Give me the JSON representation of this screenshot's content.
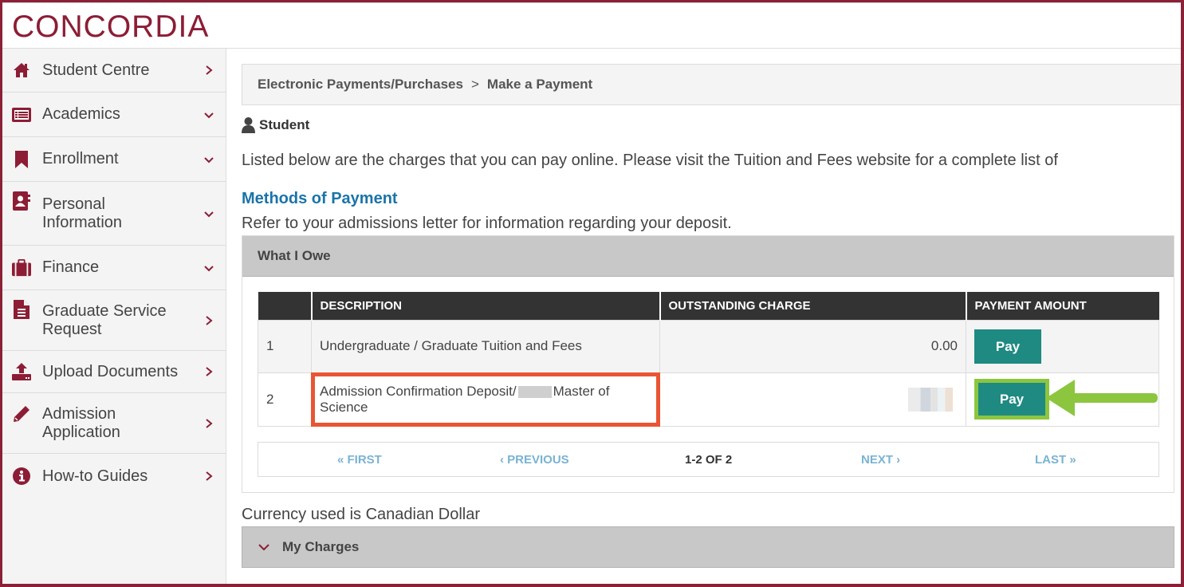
{
  "brand": {
    "logo_text": "CONCORDIA",
    "color": "#8c1d35"
  },
  "sidebar": {
    "items": [
      {
        "label": "Student Centre",
        "icon": "home-icon",
        "chevron": "right"
      },
      {
        "label": "Academics",
        "icon": "list-icon",
        "chevron": "down"
      },
      {
        "label": "Enrollment",
        "icon": "bookmark-icon",
        "chevron": "down"
      },
      {
        "label": "Personal Information",
        "line1": "Personal",
        "line2": "Information",
        "icon": "contact-book-icon",
        "chevron": "down"
      },
      {
        "label": "Finance",
        "icon": "briefcase-icon",
        "chevron": "down"
      },
      {
        "label": "Graduate Service Request",
        "line1": "Graduate Service",
        "line2": "Request",
        "icon": "document-icon",
        "chevron": "right"
      },
      {
        "label": "Upload Documents",
        "icon": "upload-icon",
        "chevron": "right"
      },
      {
        "label": "Admission Application",
        "line1": "Admission",
        "line2": "Application",
        "icon": "pencil-icon",
        "chevron": "right"
      },
      {
        "label": "How-to Guides",
        "icon": "info-icon",
        "chevron": "right"
      }
    ]
  },
  "breadcrumb": {
    "parent": "Electronic Payments/Purchases",
    "separator": ">",
    "current": "Make a Payment"
  },
  "user_role": "Student",
  "intro_text": "Listed below are the charges that you can pay online. Please visit the Tuition and Fees website for a complete list of",
  "methods_heading": "Methods of Payment",
  "refer_text": "Refer to your admissions letter for information regarding your deposit.",
  "what_i_owe": {
    "title": "What I Owe",
    "columns": [
      "",
      "DESCRIPTION",
      "OUTSTANDING CHARGE",
      "PAYMENT AMOUNT"
    ],
    "rows": [
      {
        "num": "1",
        "description": "Undergraduate / Graduate Tuition and Fees",
        "outstanding": "0.00",
        "action": "Pay"
      },
      {
        "num": "2",
        "description_prefix": "Admission Confirmation Deposit/",
        "description_suffix": "Master of Science",
        "outstanding": "[redacted]",
        "action": "Pay"
      }
    ],
    "pager": {
      "first": "FIRST",
      "previous": "PREVIOUS",
      "count": "1-2 OF 2",
      "next": "NEXT",
      "last": "LAST"
    }
  },
  "currency_note": "Currency used is Canadian Dollar",
  "my_charges": {
    "title": "My Charges"
  },
  "colors": {
    "accent": "#8c1d35",
    "pay_button": "#1e8a82",
    "link_blue": "#1a74a8",
    "highlight_box": "#e95533",
    "highlight_arrow": "#8cc63f"
  }
}
